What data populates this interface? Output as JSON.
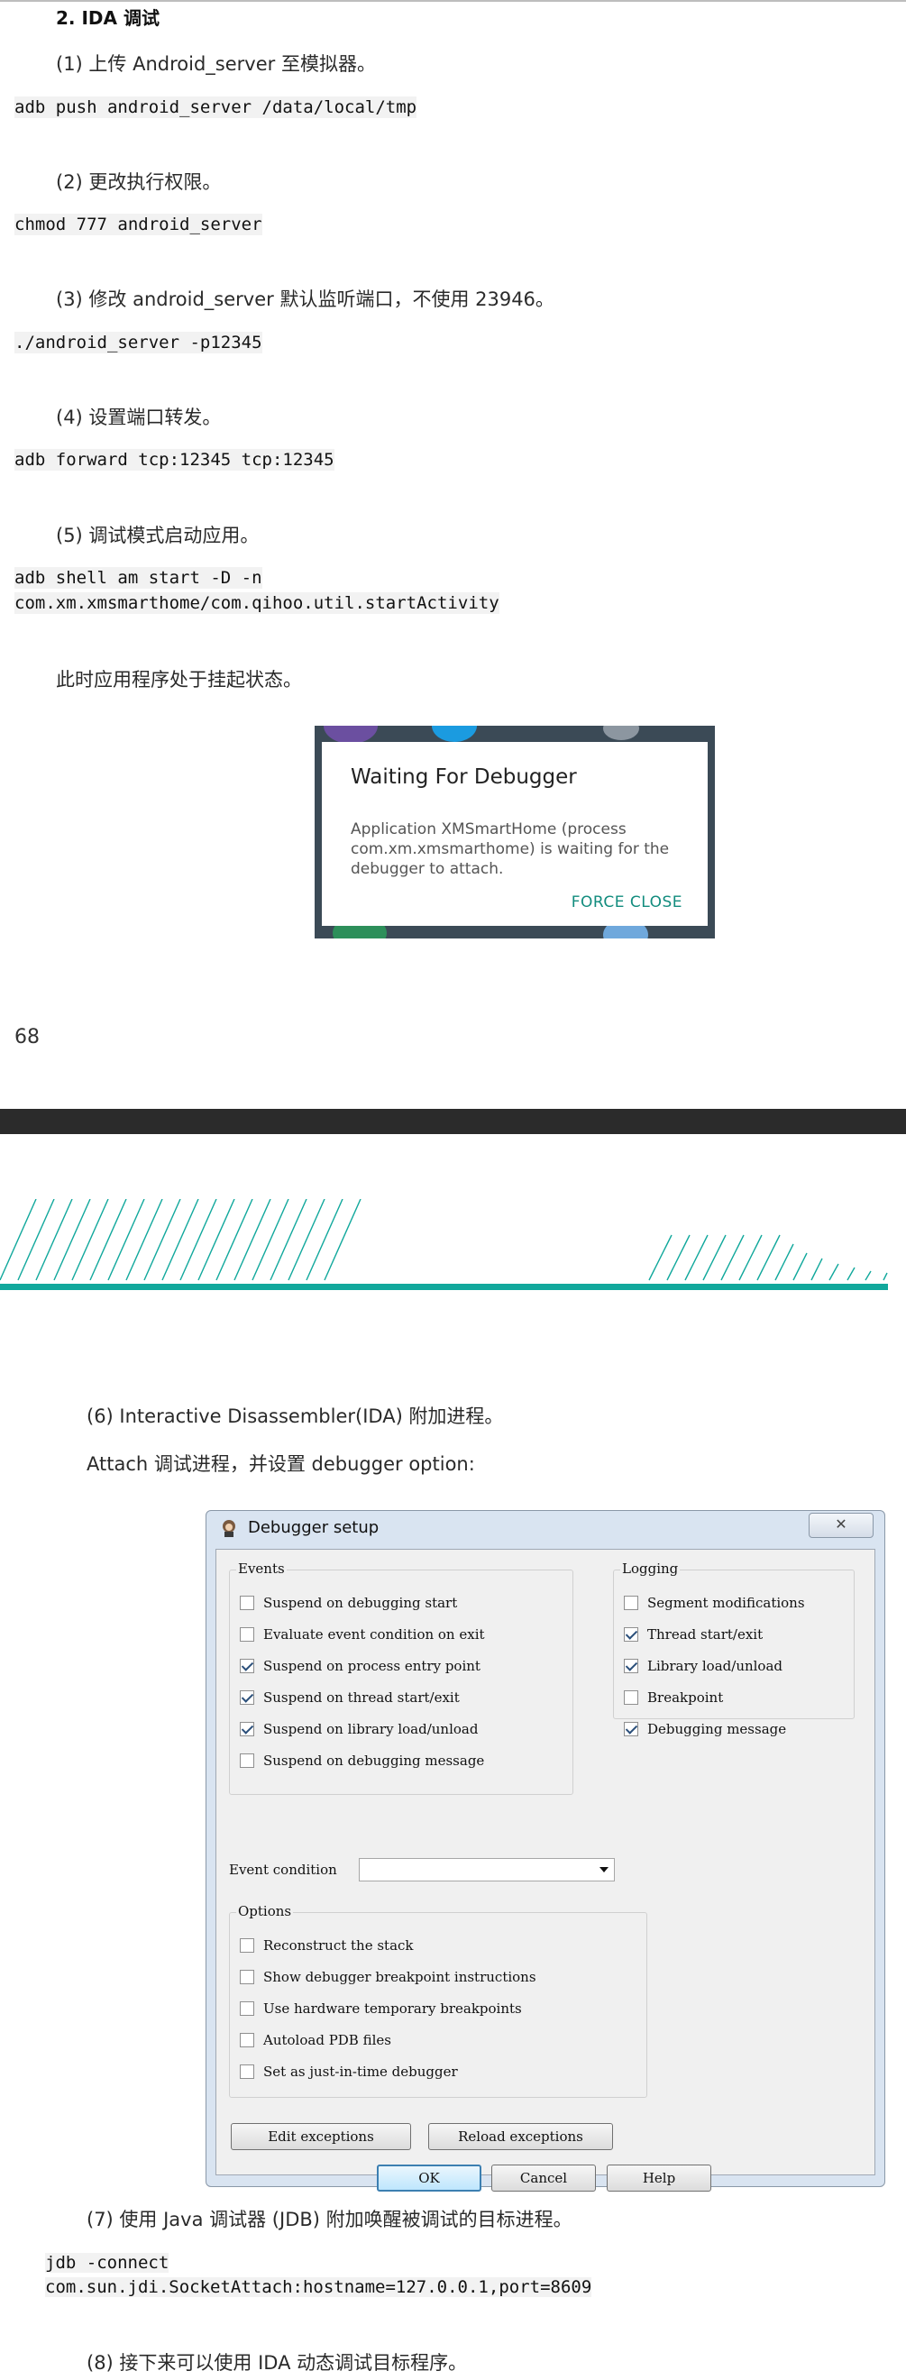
{
  "section_title": "2. IDA 调试",
  "steps": {
    "s1": "(1) 上传 Android_server 至模拟器。",
    "s2": "(2) 更改执行权限。",
    "s3": "(3) 修改 android_server 默认监听端口，不使用 23946。",
    "s4": "(4) 设置端口转发。",
    "s5": "(5) 调试模式启动应用。",
    "suspend_note": "此时应用程序处于挂起状态。",
    "s6": "(6)  Interactive Disassembler(IDA) 附加进程。",
    "s6_sub": "Attach 调试进程，并设置 debugger option:",
    "s7": "(7) 使用 Java 调试器 (JDB) 附加唤醒被调试的目标进程。",
    "s8": "(8) 接下来可以使用 IDA 动态调试目标程序。"
  },
  "code": {
    "c1": "adb push android_server /data/local/tmp",
    "c2": "chmod 777 android_server",
    "c3": "./android_server -p12345",
    "c4": "adb forward tcp:12345 tcp:12345",
    "c5a": "adb shell am start -D -n",
    "c5b": "com.xm.xmsmarthome/com.qihoo.util.startActivity",
    "c7a": "jdb -connect",
    "c7b": "com.sun.jdi.SocketAttach:hostname=127.0.0.1,port=8609"
  },
  "android_dialog": {
    "title": "Waiting For Debugger",
    "message": "Application XMSmartHome (process\ncom.xm.xmsmarthome) is waiting for the\ndebugger to attach.",
    "button": "FORCE CLOSE"
  },
  "page_number": "68",
  "debugger_setup": {
    "title": "Debugger setup",
    "events_label": "Events",
    "events": [
      {
        "label": "Suspend on debugging start",
        "checked": false
      },
      {
        "label": "Evaluate event condition on exit",
        "checked": false
      },
      {
        "label": "Suspend on process entry point",
        "checked": true
      },
      {
        "label": "Suspend on thread start/exit",
        "checked": true
      },
      {
        "label": "Suspend on library load/unload",
        "checked": true
      },
      {
        "label": "Suspend on debugging message",
        "checked": false
      }
    ],
    "logging_label": "Logging",
    "logging": [
      {
        "label": "Segment modifications",
        "checked": false
      },
      {
        "label": "Thread start/exit",
        "checked": true
      },
      {
        "label": "Library load/unload",
        "checked": true
      },
      {
        "label": "Breakpoint",
        "checked": false
      },
      {
        "label": "Debugging message",
        "checked": true
      }
    ],
    "event_condition_label": "Event condition",
    "event_condition_value": "",
    "options_label": "Options",
    "options": [
      {
        "label": "Reconstruct the stack",
        "checked": false
      },
      {
        "label": "Show debugger breakpoint instructions",
        "checked": false
      },
      {
        "label": "Use hardware temporary breakpoints",
        "checked": false
      },
      {
        "label": "Autoload PDB files",
        "checked": false
      },
      {
        "label": "Set as just-in-time debugger",
        "checked": false
      }
    ],
    "buttons": {
      "edit_exceptions": "Edit exceptions",
      "reload_exceptions": "Reload exceptions",
      "ok": "OK",
      "cancel": "Cancel",
      "help": "Help"
    }
  }
}
